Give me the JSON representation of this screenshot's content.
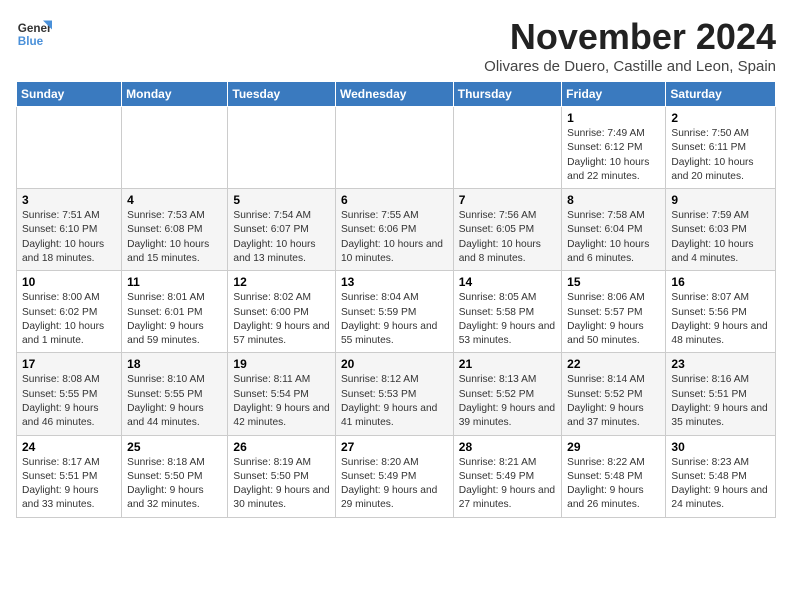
{
  "logo": {
    "line1": "General",
    "line2": "Blue"
  },
  "title": "November 2024",
  "subtitle": "Olivares de Duero, Castille and Leon, Spain",
  "days_of_week": [
    "Sunday",
    "Monday",
    "Tuesday",
    "Wednesday",
    "Thursday",
    "Friday",
    "Saturday"
  ],
  "weeks": [
    [
      {
        "day": "",
        "info": ""
      },
      {
        "day": "",
        "info": ""
      },
      {
        "day": "",
        "info": ""
      },
      {
        "day": "",
        "info": ""
      },
      {
        "day": "",
        "info": ""
      },
      {
        "day": "1",
        "info": "Sunrise: 7:49 AM\nSunset: 6:12 PM\nDaylight: 10 hours and 22 minutes."
      },
      {
        "day": "2",
        "info": "Sunrise: 7:50 AM\nSunset: 6:11 PM\nDaylight: 10 hours and 20 minutes."
      }
    ],
    [
      {
        "day": "3",
        "info": "Sunrise: 7:51 AM\nSunset: 6:10 PM\nDaylight: 10 hours and 18 minutes."
      },
      {
        "day": "4",
        "info": "Sunrise: 7:53 AM\nSunset: 6:08 PM\nDaylight: 10 hours and 15 minutes."
      },
      {
        "day": "5",
        "info": "Sunrise: 7:54 AM\nSunset: 6:07 PM\nDaylight: 10 hours and 13 minutes."
      },
      {
        "day": "6",
        "info": "Sunrise: 7:55 AM\nSunset: 6:06 PM\nDaylight: 10 hours and 10 minutes."
      },
      {
        "day": "7",
        "info": "Sunrise: 7:56 AM\nSunset: 6:05 PM\nDaylight: 10 hours and 8 minutes."
      },
      {
        "day": "8",
        "info": "Sunrise: 7:58 AM\nSunset: 6:04 PM\nDaylight: 10 hours and 6 minutes."
      },
      {
        "day": "9",
        "info": "Sunrise: 7:59 AM\nSunset: 6:03 PM\nDaylight: 10 hours and 4 minutes."
      }
    ],
    [
      {
        "day": "10",
        "info": "Sunrise: 8:00 AM\nSunset: 6:02 PM\nDaylight: 10 hours and 1 minute."
      },
      {
        "day": "11",
        "info": "Sunrise: 8:01 AM\nSunset: 6:01 PM\nDaylight: 9 hours and 59 minutes."
      },
      {
        "day": "12",
        "info": "Sunrise: 8:02 AM\nSunset: 6:00 PM\nDaylight: 9 hours and 57 minutes."
      },
      {
        "day": "13",
        "info": "Sunrise: 8:04 AM\nSunset: 5:59 PM\nDaylight: 9 hours and 55 minutes."
      },
      {
        "day": "14",
        "info": "Sunrise: 8:05 AM\nSunset: 5:58 PM\nDaylight: 9 hours and 53 minutes."
      },
      {
        "day": "15",
        "info": "Sunrise: 8:06 AM\nSunset: 5:57 PM\nDaylight: 9 hours and 50 minutes."
      },
      {
        "day": "16",
        "info": "Sunrise: 8:07 AM\nSunset: 5:56 PM\nDaylight: 9 hours and 48 minutes."
      }
    ],
    [
      {
        "day": "17",
        "info": "Sunrise: 8:08 AM\nSunset: 5:55 PM\nDaylight: 9 hours and 46 minutes."
      },
      {
        "day": "18",
        "info": "Sunrise: 8:10 AM\nSunset: 5:55 PM\nDaylight: 9 hours and 44 minutes."
      },
      {
        "day": "19",
        "info": "Sunrise: 8:11 AM\nSunset: 5:54 PM\nDaylight: 9 hours and 42 minutes."
      },
      {
        "day": "20",
        "info": "Sunrise: 8:12 AM\nSunset: 5:53 PM\nDaylight: 9 hours and 41 minutes."
      },
      {
        "day": "21",
        "info": "Sunrise: 8:13 AM\nSunset: 5:52 PM\nDaylight: 9 hours and 39 minutes."
      },
      {
        "day": "22",
        "info": "Sunrise: 8:14 AM\nSunset: 5:52 PM\nDaylight: 9 hours and 37 minutes."
      },
      {
        "day": "23",
        "info": "Sunrise: 8:16 AM\nSunset: 5:51 PM\nDaylight: 9 hours and 35 minutes."
      }
    ],
    [
      {
        "day": "24",
        "info": "Sunrise: 8:17 AM\nSunset: 5:51 PM\nDaylight: 9 hours and 33 minutes."
      },
      {
        "day": "25",
        "info": "Sunrise: 8:18 AM\nSunset: 5:50 PM\nDaylight: 9 hours and 32 minutes."
      },
      {
        "day": "26",
        "info": "Sunrise: 8:19 AM\nSunset: 5:50 PM\nDaylight: 9 hours and 30 minutes."
      },
      {
        "day": "27",
        "info": "Sunrise: 8:20 AM\nSunset: 5:49 PM\nDaylight: 9 hours and 29 minutes."
      },
      {
        "day": "28",
        "info": "Sunrise: 8:21 AM\nSunset: 5:49 PM\nDaylight: 9 hours and 27 minutes."
      },
      {
        "day": "29",
        "info": "Sunrise: 8:22 AM\nSunset: 5:48 PM\nDaylight: 9 hours and 26 minutes."
      },
      {
        "day": "30",
        "info": "Sunrise: 8:23 AM\nSunset: 5:48 PM\nDaylight: 9 hours and 24 minutes."
      }
    ]
  ]
}
